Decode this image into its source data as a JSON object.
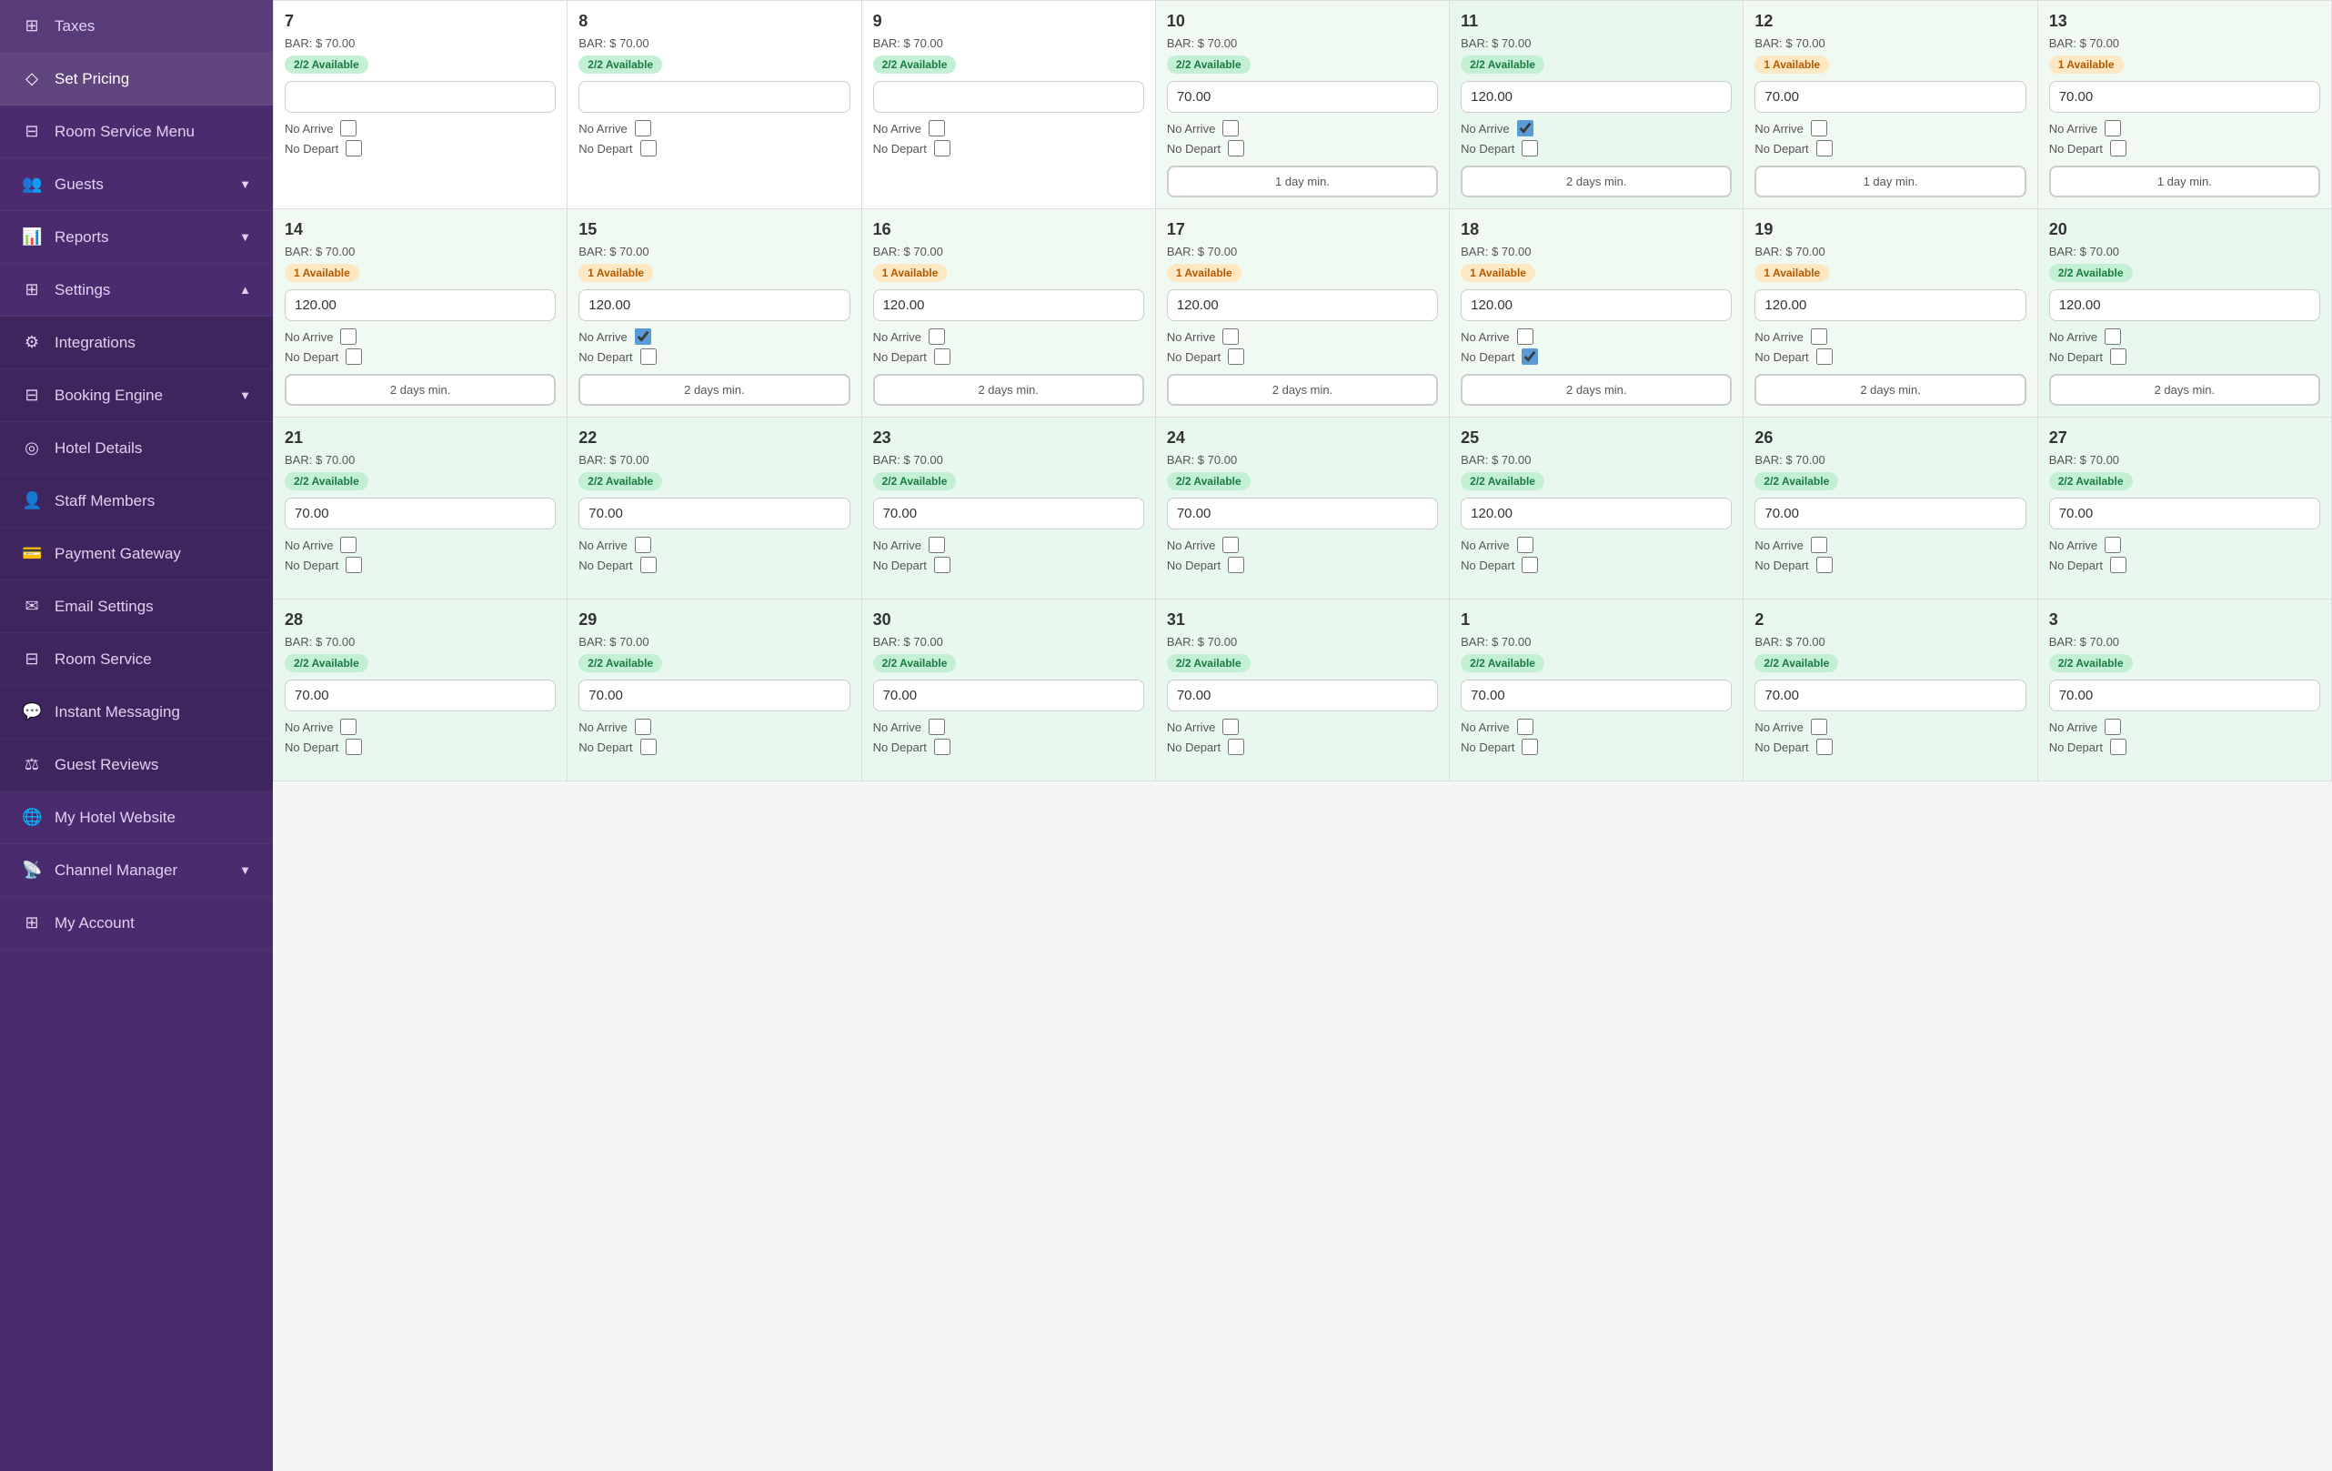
{
  "sidebar": {
    "items": [
      {
        "id": "taxes",
        "label": "Taxes",
        "icon": "⊞",
        "expandable": false
      },
      {
        "id": "set-pricing",
        "label": "Set Pricing",
        "icon": "◇",
        "expandable": false,
        "active": true
      },
      {
        "id": "room-service-menu",
        "label": "Room Service Menu",
        "icon": "⊟",
        "expandable": false
      },
      {
        "id": "guests",
        "label": "Guests",
        "icon": "👥",
        "expandable": true
      },
      {
        "id": "reports",
        "label": "Reports",
        "icon": "📊",
        "expandable": true
      },
      {
        "id": "settings",
        "label": "Settings",
        "icon": "⊞",
        "expandable": true,
        "expanded": true
      },
      {
        "id": "integrations",
        "label": "Integrations",
        "icon": "⚙",
        "sub": true
      },
      {
        "id": "booking-engine",
        "label": "Booking Engine",
        "icon": "⊟",
        "sub": true,
        "expandable": true
      },
      {
        "id": "hotel-details",
        "label": "Hotel Details",
        "icon": "◎",
        "sub": true
      },
      {
        "id": "staff-members",
        "label": "Staff Members",
        "icon": "👤",
        "sub": true
      },
      {
        "id": "payment-gateway",
        "label": "Payment Gateway",
        "icon": "💳",
        "sub": true
      },
      {
        "id": "email-settings",
        "label": "Email Settings",
        "icon": "✉",
        "sub": true
      },
      {
        "id": "room-service",
        "label": "Room Service",
        "icon": "⊟",
        "sub": true
      },
      {
        "id": "instant-messaging",
        "label": "Instant Messaging",
        "icon": "💬",
        "sub": true
      },
      {
        "id": "guest-reviews",
        "label": "Guest Reviews",
        "icon": "⚖",
        "sub": true
      },
      {
        "id": "my-hotel-website",
        "label": "My Hotel Website",
        "icon": "🌐",
        "sub": false
      },
      {
        "id": "channel-manager",
        "label": "Channel Manager",
        "icon": "📡",
        "expandable": true
      },
      {
        "id": "my-account",
        "label": "My Account",
        "icon": "⊞",
        "expandable": false
      }
    ]
  },
  "calendar": {
    "weeks": [
      {
        "days": [
          {
            "num": 7,
            "bar": "$ 70.00",
            "avail": "2/2 Available",
            "availType": "green",
            "price": "",
            "noArrive": false,
            "noDepart": false,
            "minDays": null,
            "bg": "white"
          },
          {
            "num": 8,
            "bar": "$ 70.00",
            "avail": "2/2 Available",
            "availType": "green",
            "price": "",
            "noArrive": false,
            "noDepart": false,
            "minDays": null,
            "bg": "white"
          },
          {
            "num": 9,
            "bar": "$ 70.00",
            "avail": "2/2 Available",
            "availType": "green",
            "price": "",
            "noArrive": false,
            "noDepart": false,
            "minDays": null,
            "bg": "white"
          },
          {
            "num": 10,
            "bar": "$ 70.00",
            "avail": "2/2 Available",
            "availType": "green",
            "price": "70.00",
            "noArrive": false,
            "noDepart": false,
            "minDays": "1 day min.",
            "bg": "light-green"
          },
          {
            "num": 11,
            "bar": "$ 70.00",
            "avail": "2/2 Available",
            "availType": "green",
            "price": "120.00",
            "noArrive": true,
            "noDepart": false,
            "minDays": "2 days min.",
            "bg": "green"
          },
          {
            "num": 12,
            "bar": "$ 70.00",
            "avail": "1 Available",
            "availType": "orange",
            "price": "70.00",
            "noArrive": false,
            "noDepart": false,
            "minDays": "1 day min.",
            "bg": "light-green"
          },
          {
            "num": 13,
            "bar": "$ 70.00",
            "avail": "1 Available",
            "availType": "orange",
            "price": "70.00",
            "noArrive": false,
            "noDepart": false,
            "minDays": "1 day min.",
            "bg": "light-green"
          }
        ]
      },
      {
        "days": [
          {
            "num": 14,
            "bar": "$ 70.00",
            "avail": "1 Available",
            "availType": "orange",
            "price": "120.00",
            "noArrive": false,
            "noDepart": false,
            "minDays": "2 days min.",
            "bg": "light-green"
          },
          {
            "num": 15,
            "bar": "$ 70.00",
            "avail": "1 Available",
            "availType": "orange",
            "price": "120.00",
            "noArrive": true,
            "noDepart": false,
            "minDays": "2 days min.",
            "bg": "light-green"
          },
          {
            "num": 16,
            "bar": "$ 70.00",
            "avail": "1 Available",
            "availType": "orange",
            "price": "120.00",
            "noArrive": false,
            "noDepart": false,
            "minDays": "2 days min.",
            "bg": "light-green"
          },
          {
            "num": 17,
            "bar": "$ 70.00",
            "avail": "1 Available",
            "availType": "orange",
            "price": "120.00",
            "noArrive": false,
            "noDepart": false,
            "minDays": "2 days min.",
            "bg": "light-green"
          },
          {
            "num": 18,
            "bar": "$ 70.00",
            "avail": "1 Available",
            "availType": "orange",
            "price": "120.00",
            "noArrive": false,
            "noDepart": true,
            "minDays": "2 days min.",
            "bg": "light-green"
          },
          {
            "num": 19,
            "bar": "$ 70.00",
            "avail": "1 Available",
            "availType": "orange",
            "price": "120.00",
            "noArrive": false,
            "noDepart": false,
            "minDays": "2 days min.",
            "bg": "light-green"
          },
          {
            "num": 20,
            "bar": "$ 70.00",
            "avail": "2/2 Available",
            "availType": "green",
            "price": "120.00",
            "noArrive": false,
            "noDepart": false,
            "minDays": "2 days min.",
            "bg": "green"
          }
        ]
      },
      {
        "days": [
          {
            "num": 21,
            "bar": "$ 70.00",
            "avail": "2/2 Available",
            "availType": "green",
            "price": "70.00",
            "noArrive": false,
            "noDepart": false,
            "minDays": null,
            "bg": "green"
          },
          {
            "num": 22,
            "bar": "$ 70.00",
            "avail": "2/2 Available",
            "availType": "green",
            "price": "70.00",
            "noArrive": false,
            "noDepart": false,
            "minDays": null,
            "bg": "green"
          },
          {
            "num": 23,
            "bar": "$ 70.00",
            "avail": "2/2 Available",
            "availType": "green",
            "price": "70.00",
            "noArrive": false,
            "noDepart": false,
            "minDays": null,
            "bg": "green"
          },
          {
            "num": 24,
            "bar": "$ 70.00",
            "avail": "2/2 Available",
            "availType": "green",
            "price": "70.00",
            "noArrive": false,
            "noDepart": false,
            "minDays": null,
            "bg": "green"
          },
          {
            "num": 25,
            "bar": "$ 70.00",
            "avail": "2/2 Available",
            "availType": "green",
            "price": "120.00",
            "noArrive": false,
            "noDepart": false,
            "minDays": null,
            "bg": "green"
          },
          {
            "num": 26,
            "bar": "$ 70.00",
            "avail": "2/2 Available",
            "availType": "green",
            "price": "70.00",
            "noArrive": false,
            "noDepart": false,
            "minDays": null,
            "bg": "green"
          },
          {
            "num": 27,
            "bar": "$ 70.00",
            "avail": "2/2 Available",
            "availType": "green",
            "price": "70.00",
            "noArrive": false,
            "noDepart": false,
            "minDays": null,
            "bg": "green"
          }
        ]
      },
      {
        "days": [
          {
            "num": 28,
            "bar": "$ 70.00",
            "avail": "2/2 Available",
            "availType": "green",
            "price": "70.00",
            "noArrive": false,
            "noDepart": false,
            "minDays": null,
            "bg": "green"
          },
          {
            "num": 29,
            "bar": "$ 70.00",
            "avail": "2/2 Available",
            "availType": "green",
            "price": "70.00",
            "noArrive": false,
            "noDepart": false,
            "minDays": null,
            "bg": "green"
          },
          {
            "num": 30,
            "bar": "$ 70.00",
            "avail": "2/2 Available",
            "availType": "green",
            "price": "70.00",
            "noArrive": false,
            "noDepart": false,
            "minDays": null,
            "bg": "green"
          },
          {
            "num": 31,
            "bar": "$ 70.00",
            "avail": "2/2 Available",
            "availType": "green",
            "price": "70.00",
            "noArrive": false,
            "noDepart": false,
            "minDays": null,
            "bg": "green"
          },
          {
            "num": 1,
            "bar": "$ 70.00",
            "avail": "2/2 Available",
            "availType": "green",
            "price": "70.00",
            "noArrive": false,
            "noDepart": false,
            "minDays": null,
            "bg": "green"
          },
          {
            "num": 2,
            "bar": "$ 70.00",
            "avail": "2/2 Available",
            "availType": "green",
            "price": "70.00",
            "noArrive": false,
            "noDepart": false,
            "minDays": null,
            "bg": "green"
          },
          {
            "num": 3,
            "bar": "$ 70.00",
            "avail": "2/2 Available",
            "availType": "green",
            "price": "70.00",
            "noArrive": false,
            "noDepart": false,
            "minDays": null,
            "bg": "green"
          }
        ]
      }
    ],
    "labels": {
      "bar": "BAR:",
      "noArrive": "No Arrive",
      "noDepart": "No Depart"
    }
  }
}
